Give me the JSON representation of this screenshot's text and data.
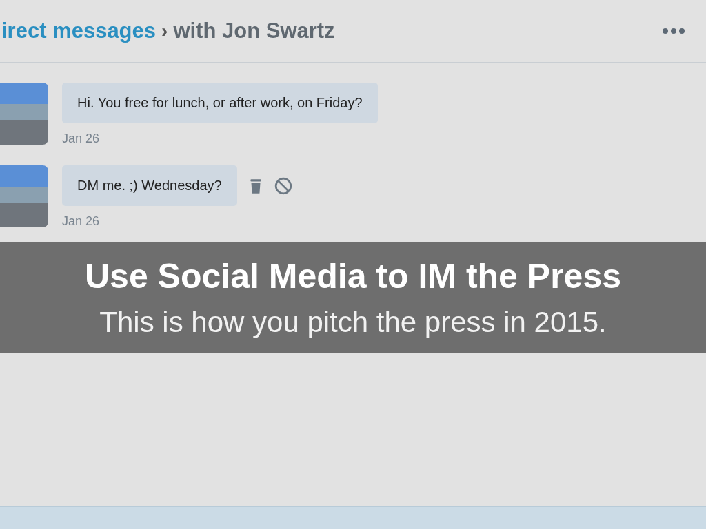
{
  "header": {
    "title": "irect messages",
    "separator": "›",
    "subtitle": "with Jon Swartz"
  },
  "messages": [
    {
      "text": "Hi. You free for lunch, or after work, on Friday?",
      "date": "Jan 26",
      "actions": false
    },
    {
      "text": "DM me. ;) Wednesday?",
      "date": "Jan 26",
      "actions": true
    }
  ],
  "overlay": {
    "title": "Use Social Media to IM the Press",
    "subtitle": "This is how you pitch the press in 2015."
  }
}
